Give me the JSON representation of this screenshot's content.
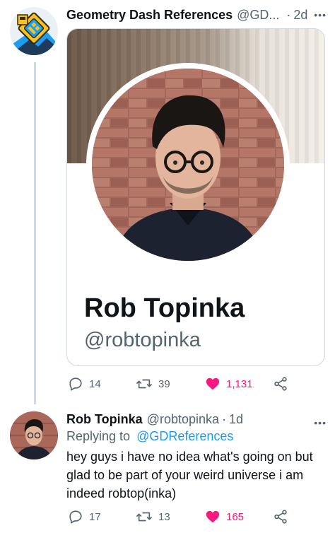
{
  "tweet1": {
    "author_name": "Geometry Dash References",
    "author_handle": "@GD...",
    "time": "2d",
    "card": {
      "name": "Rob Topinka",
      "handle": "@robtopinka"
    },
    "actions": {
      "replies": "14",
      "retweets": "39",
      "likes": "1,131"
    }
  },
  "tweet2": {
    "author_name": "Rob Topinka",
    "author_handle": "@robtopinka",
    "time": "1d",
    "replying_prefix": "Replying to",
    "replying_to": "@GDReferences",
    "text": "hey guys i have no idea what's going on but glad to be part of your weird universe i am indeed robtop(inka)",
    "actions": {
      "replies": "17",
      "retweets": "13",
      "likes": "165"
    }
  },
  "colors": {
    "like": "#f91880",
    "link": "#1d9bf0",
    "secondary_text": "#536471",
    "gd_logo_yellow": "#f6c325",
    "gd_logo_blue": "#1c9ff0"
  },
  "icons": [
    "reply-icon",
    "retweet-icon",
    "like-heart-icon",
    "share-icon",
    "more-icon"
  ]
}
